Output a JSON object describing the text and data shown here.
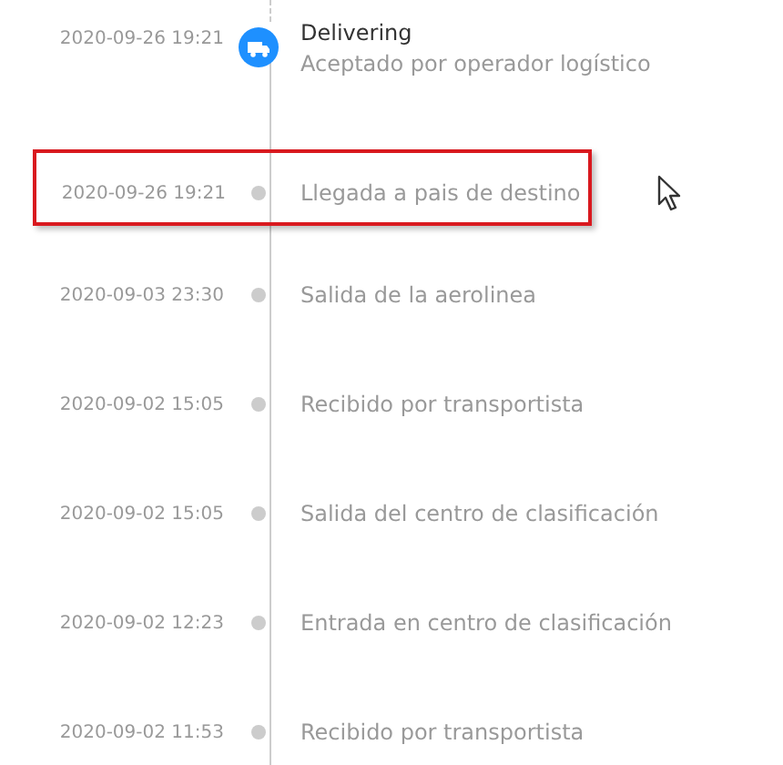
{
  "events": [
    {
      "time": "2020-09-26 19:21",
      "title": "Delivering",
      "description": "Aceptado por operador logístico",
      "current": true,
      "highlighted": false
    },
    {
      "time": "2020-09-26 19:21",
      "description": "Llegada a pais de destino",
      "current": false,
      "highlighted": true
    },
    {
      "time": "2020-09-03 23:30",
      "description": "Salida de la aerolinea",
      "current": false,
      "highlighted": false
    },
    {
      "time": "2020-09-02 15:05",
      "description": "Recibido por transportista",
      "current": false,
      "highlighted": false
    },
    {
      "time": "2020-09-02 15:05",
      "description": "Salida del centro de clasificación",
      "current": false,
      "highlighted": false
    },
    {
      "time": "2020-09-02 12:23",
      "description": "Entrada en centro de clasificación",
      "current": false,
      "highlighted": false
    },
    {
      "time": "2020-09-02 11:53",
      "description": "Recibido por transportista",
      "current": false,
      "highlighted": false
    }
  ]
}
